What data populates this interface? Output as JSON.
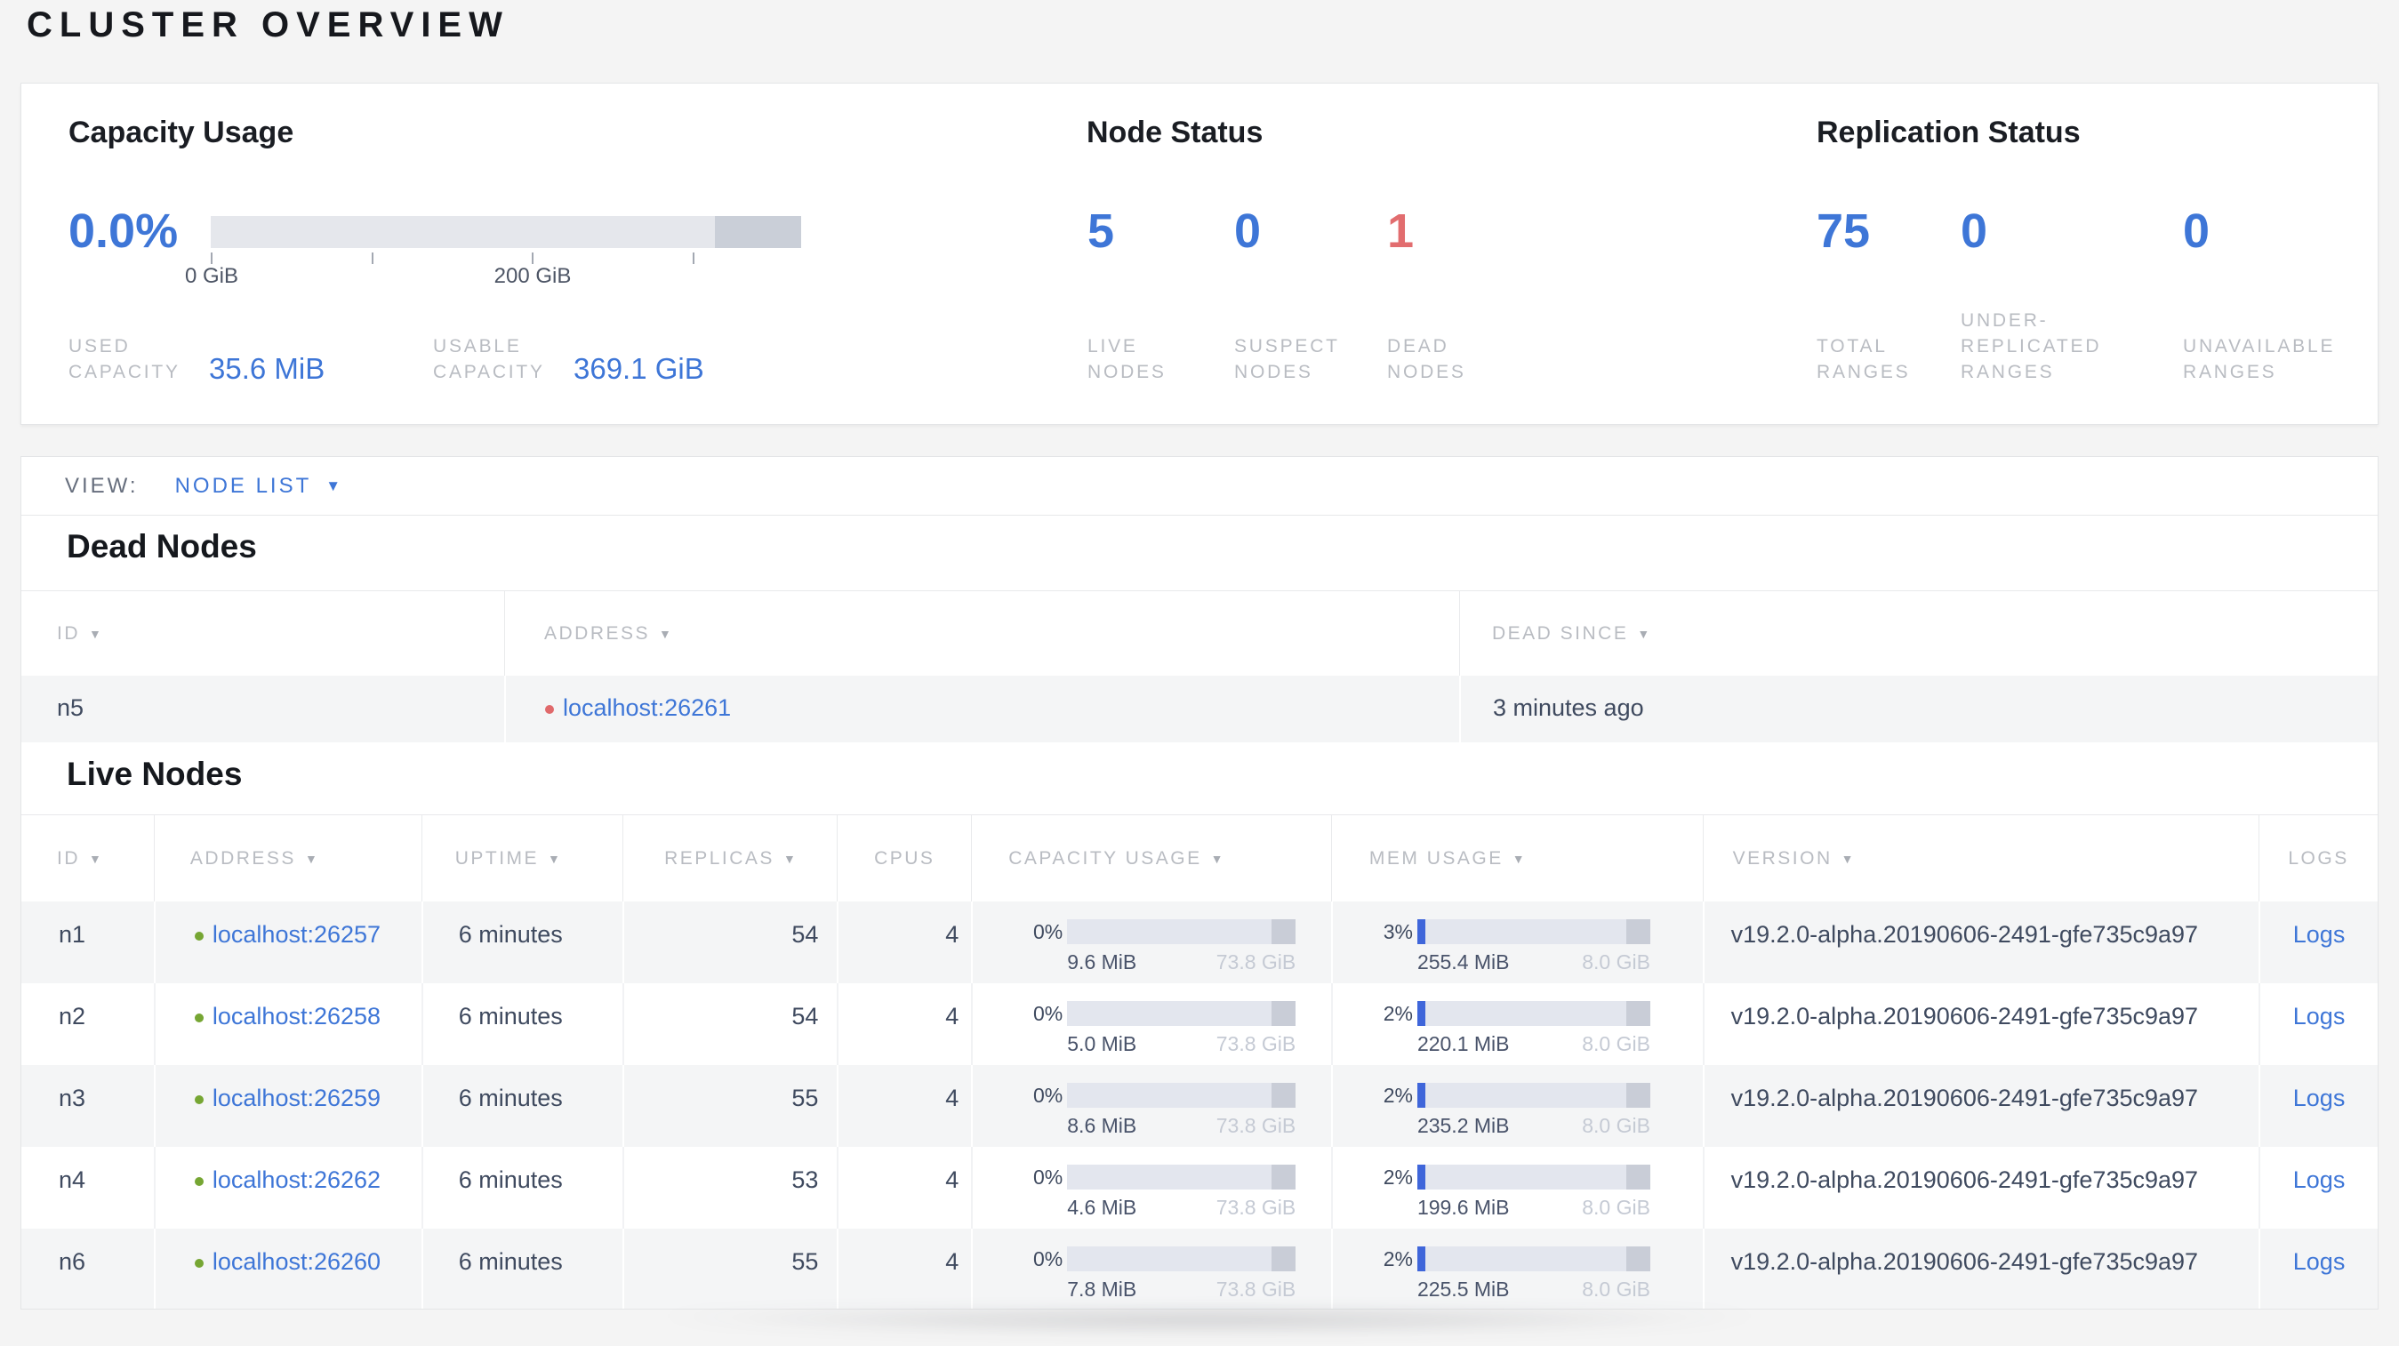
{
  "page_title": "CLUSTER OVERVIEW",
  "icons": {
    "sort_descending": "▼",
    "dropdown_arrow": "▼"
  },
  "colors": {
    "accent_blue": "#3e76d7",
    "dead_red": "#e26d6f",
    "live_green": "#76a633",
    "bar_track": "#e3e6ee",
    "bar_reserved": "#c9cdd7"
  },
  "summary": {
    "capacity_usage": {
      "title": "Capacity Usage",
      "percent": "0.0%",
      "bar": {
        "used_pct": 0,
        "tick_labels": [
          "0 GiB",
          "200 GiB"
        ]
      },
      "used": {
        "label": "USED CAPACITY",
        "value": "35.6 MiB"
      },
      "usable": {
        "label": "USABLE CAPACITY",
        "value": "369.1 GiB"
      }
    },
    "node_status": {
      "title": "Node Status",
      "metrics": [
        {
          "value": "5",
          "label": "LIVE NODES"
        },
        {
          "value": "0",
          "label": "SUSPECT NODES"
        },
        {
          "value": "1",
          "label": "DEAD NODES"
        }
      ]
    },
    "replication_status": {
      "title": "Replication Status",
      "metrics": [
        {
          "value": "75",
          "label": "TOTAL RANGES"
        },
        {
          "value": "0",
          "label": "UNDER-REPLICATED RANGES"
        },
        {
          "value": "0",
          "label": "UNAVAILABLE RANGES"
        }
      ]
    }
  },
  "view_bar": {
    "label": "VIEW:",
    "selected": "NODE LIST"
  },
  "dead_nodes": {
    "heading": "Dead Nodes",
    "columns": [
      {
        "label": "ID"
      },
      {
        "label": "ADDRESS"
      },
      {
        "label": "DEAD SINCE"
      }
    ],
    "rows": [
      {
        "id": "n5",
        "address": "localhost:26261",
        "dead_since": "3 minutes ago"
      }
    ]
  },
  "live_nodes": {
    "heading": "Live Nodes",
    "columns": [
      {
        "label": "ID"
      },
      {
        "label": "ADDRESS"
      },
      {
        "label": "UPTIME"
      },
      {
        "label": "REPLICAS"
      },
      {
        "label": "CPUS"
      },
      {
        "label": "CAPACITY USAGE"
      },
      {
        "label": "MEM USAGE"
      },
      {
        "label": "VERSION"
      },
      {
        "label": "LOGS"
      }
    ],
    "rows": [
      {
        "id": "n1",
        "address": "localhost:26257",
        "uptime": "6 minutes",
        "replicas": "54",
        "cpus": "4",
        "capacity": {
          "pct_label": "0%",
          "pct": 0,
          "used": "9.6 MiB",
          "max": "73.8 GiB"
        },
        "memory": {
          "pct_label": "3%",
          "pct": 3,
          "used": "255.4 MiB",
          "max": "8.0 GiB"
        },
        "version": "v19.2.0-alpha.20190606-2491-gfe735c9a97",
        "logs_label": "Logs"
      },
      {
        "id": "n2",
        "address": "localhost:26258",
        "uptime": "6 minutes",
        "replicas": "54",
        "cpus": "4",
        "capacity": {
          "pct_label": "0%",
          "pct": 0,
          "used": "5.0 MiB",
          "max": "73.8 GiB"
        },
        "memory": {
          "pct_label": "2%",
          "pct": 2,
          "used": "220.1 MiB",
          "max": "8.0 GiB"
        },
        "version": "v19.2.0-alpha.20190606-2491-gfe735c9a97",
        "logs_label": "Logs"
      },
      {
        "id": "n3",
        "address": "localhost:26259",
        "uptime": "6 minutes",
        "replicas": "55",
        "cpus": "4",
        "capacity": {
          "pct_label": "0%",
          "pct": 0,
          "used": "8.6 MiB",
          "max": "73.8 GiB"
        },
        "memory": {
          "pct_label": "2%",
          "pct": 2,
          "used": "235.2 MiB",
          "max": "8.0 GiB"
        },
        "version": "v19.2.0-alpha.20190606-2491-gfe735c9a97",
        "logs_label": "Logs"
      },
      {
        "id": "n4",
        "address": "localhost:26262",
        "uptime": "6 minutes",
        "replicas": "53",
        "cpus": "4",
        "capacity": {
          "pct_label": "0%",
          "pct": 0,
          "used": "4.6 MiB",
          "max": "73.8 GiB"
        },
        "memory": {
          "pct_label": "2%",
          "pct": 2,
          "used": "199.6 MiB",
          "max": "8.0 GiB"
        },
        "version": "v19.2.0-alpha.20190606-2491-gfe735c9a97",
        "logs_label": "Logs"
      },
      {
        "id": "n6",
        "address": "localhost:26260",
        "uptime": "6 minutes",
        "replicas": "55",
        "cpus": "4",
        "capacity": {
          "pct_label": "0%",
          "pct": 0,
          "used": "7.8 MiB",
          "max": "73.8 GiB"
        },
        "memory": {
          "pct_label": "2%",
          "pct": 2,
          "used": "225.5 MiB",
          "max": "8.0 GiB"
        },
        "version": "v19.2.0-alpha.20190606-2491-gfe735c9a97",
        "logs_label": "Logs"
      }
    ]
  }
}
